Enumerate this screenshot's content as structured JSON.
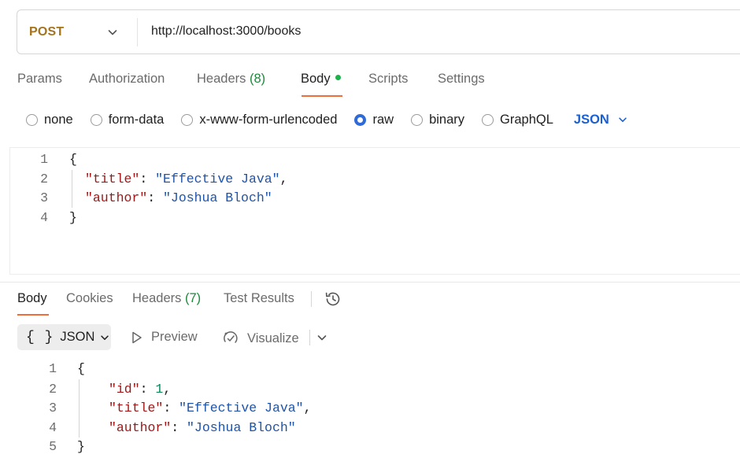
{
  "request": {
    "method": "POST",
    "url": "http://localhost:3000/books",
    "tabs": {
      "params": "Params",
      "authorization": "Authorization",
      "headers": "Headers",
      "headers_count": "(8)",
      "body": "Body",
      "scripts": "Scripts",
      "settings": "Settings"
    },
    "body_types": {
      "none": "none",
      "form_data": "form-data",
      "urlencoded": "x-www-form-urlencoded",
      "raw": "raw",
      "binary": "binary",
      "graphql": "GraphQL",
      "selected": "raw"
    },
    "language": "JSON",
    "code": {
      "line_numbers": [
        "1",
        "2",
        "3",
        "4"
      ],
      "open_brace": "{",
      "close_brace": "}",
      "title_key": "\"title\"",
      "title_value": "\"Effective Java\"",
      "author_key": "\"author\"",
      "author_value": "\"Joshua Bloch\""
    }
  },
  "response": {
    "tabs": {
      "body": "Body",
      "cookies": "Cookies",
      "headers": "Headers",
      "headers_count": "(7)",
      "test_results": "Test Results"
    },
    "format": "JSON",
    "format_braces": "{ }",
    "preview": "Preview",
    "visualize": "Visualize",
    "code": {
      "line_numbers": [
        "1",
        "2",
        "3",
        "4",
        "5"
      ],
      "open_brace": "{",
      "close_brace": "}",
      "id_key": "\"id\"",
      "id_value": "1",
      "title_key": "\"title\"",
      "title_value": "\"Effective Java\"",
      "author_key": "\"author\"",
      "author_value": "\"Joshua Bloch\""
    }
  },
  "icons": {
    "method_dropdown": "chevron-down-icon",
    "language_dropdown": "chevron-down-icon",
    "history": "history-icon",
    "preview": "play-outline-icon",
    "visualize": "visualize-icon",
    "more": "chevron-down-icon"
  },
  "colors": {
    "method": "#a4731d",
    "accent_underline": "#f26b3a",
    "active_dot": "#1bb34a",
    "count": "#1b8a3a",
    "radio_selected": "#2f6bd8",
    "language": "#1a5fd3",
    "json_key": "#a31515",
    "json_string": "#1f53a8",
    "json_number": "#098658"
  }
}
